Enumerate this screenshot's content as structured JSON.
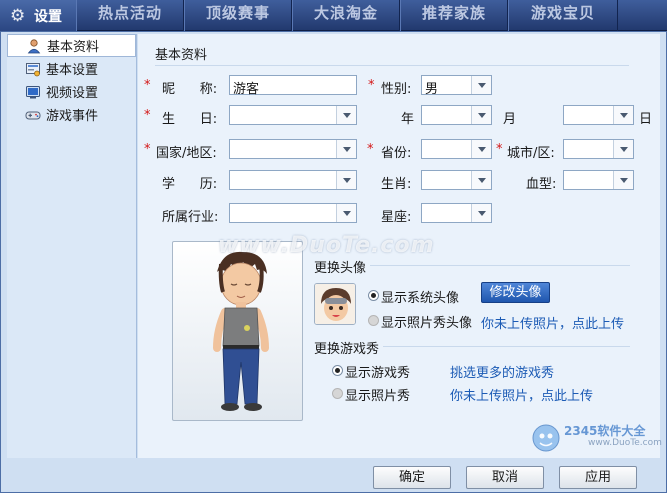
{
  "top_tabs": [
    "热点活动",
    "顶级赛事",
    "大浪淘金",
    "推荐家族",
    "游戏宝贝"
  ],
  "window": {
    "title": "设置",
    "icon": "gear-icon"
  },
  "sidebar": {
    "items": [
      {
        "label": "基本资料",
        "icon": "user-icon",
        "active": true
      },
      {
        "label": "基本设置",
        "icon": "settings-panel-icon",
        "active": false
      },
      {
        "label": "视频设置",
        "icon": "video-icon",
        "active": false
      },
      {
        "label": "游戏事件",
        "icon": "gamepad-icon",
        "active": false
      }
    ]
  },
  "profile": {
    "section_title": "基本资料",
    "required_mark": "*",
    "nickname": {
      "label": "昵      称:",
      "value": "游客"
    },
    "gender": {
      "label": "性别:",
      "value": "男"
    },
    "birthday": {
      "label": "生      日:",
      "year_label": "年",
      "month_label": "月",
      "day_label": "日",
      "value": "",
      "year": "",
      "month": "",
      "day": ""
    },
    "country": {
      "label": "国家/地区:",
      "value": ""
    },
    "province": {
      "label": "省份:",
      "value": ""
    },
    "city": {
      "label": "城市/区:",
      "value": ""
    },
    "education": {
      "label": "学      历:",
      "value": ""
    },
    "zodiac": {
      "label": "生肖:",
      "value": ""
    },
    "blood_type": {
      "label": "血型:",
      "value": ""
    },
    "industry": {
      "label": "所属行业:",
      "value": ""
    },
    "constellation": {
      "label": "星座:",
      "value": ""
    }
  },
  "avatar": {
    "change_title": "更换头像",
    "option_system": "显示系统头像",
    "option_photo": "显示照片秀头像",
    "selected": "system",
    "modify_button": "修改头像",
    "upload_hint": "你未上传照片，点此上传"
  },
  "game_show": {
    "title": "更换游戏秀",
    "option_game": "显示游戏秀",
    "option_photo": "显示照片秀",
    "selected": "game",
    "more_link": "挑选更多的游戏秀",
    "upload_hint": "你未上传照片，点此上传"
  },
  "footer": {
    "ok": "确定",
    "cancel": "取消",
    "apply": "应用"
  },
  "watermarks": {
    "site": "www.DuoTe.com",
    "logo_text": "2345软件大全",
    "logo_url": "www.DuoTe.com"
  },
  "colors": {
    "accent_blue": "#2a5fb8",
    "required_red": "#d31414",
    "link_blue": "#1c5bb5",
    "panel_bg": "#eaf2fb"
  }
}
